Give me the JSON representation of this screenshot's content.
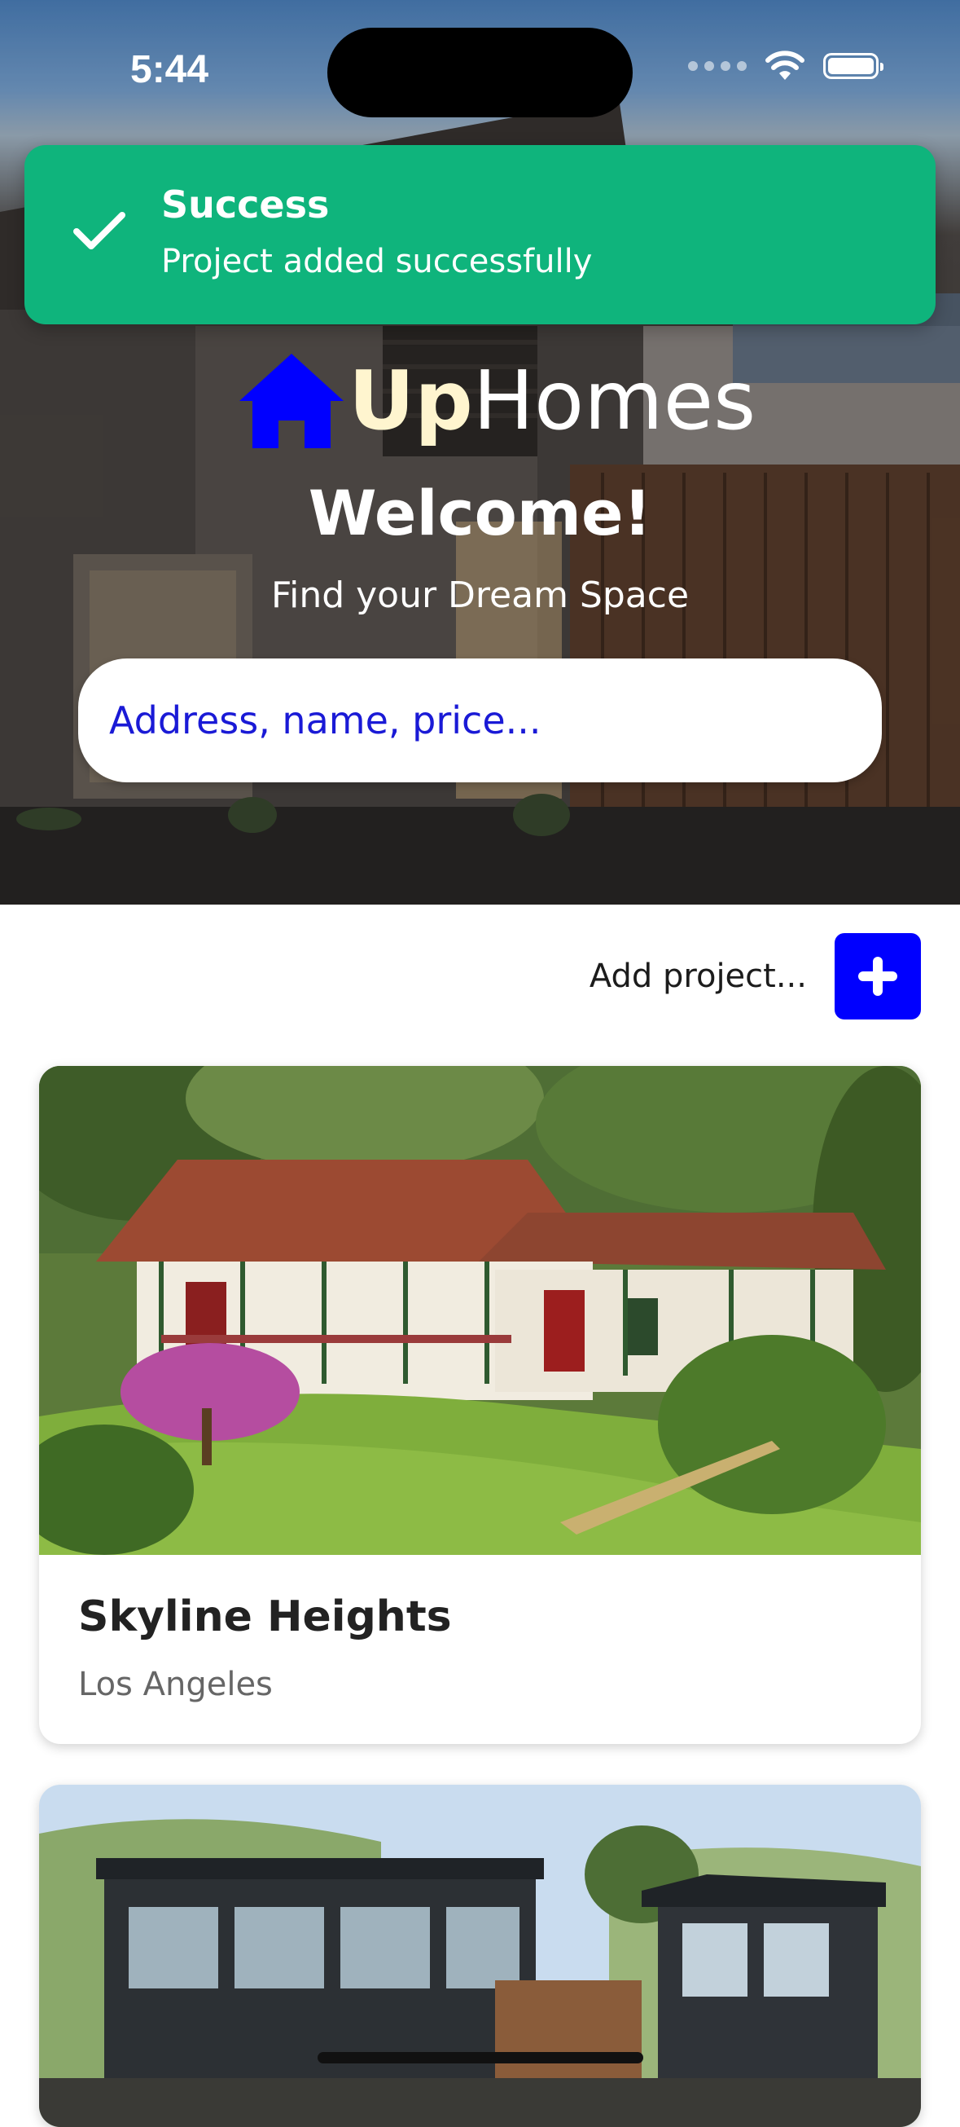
{
  "status_bar": {
    "time": "5:44"
  },
  "toast": {
    "title": "Success",
    "message": "Project added successfully"
  },
  "brand": {
    "part1": "Up",
    "part2": "Homes"
  },
  "hero": {
    "welcome": "Welcome!",
    "tagline": "Find your Dream Space",
    "search_placeholder": "Address, name, price..."
  },
  "actions": {
    "add_project_label": "Add project..."
  },
  "projects": [
    {
      "title": "Skyline Heights",
      "location": "Los Angeles"
    },
    {
      "title": "",
      "location": ""
    }
  ],
  "colors": {
    "toast": "#0fb47c",
    "accent": "#0000ff",
    "brand_up": "#fff5cf",
    "placeholder": "#1a1ad6"
  },
  "icons": {
    "toast": "checkmark-icon",
    "brand": "house-icon",
    "add": "plus-icon",
    "wifi": "wifi-icon",
    "battery": "battery-icon"
  }
}
